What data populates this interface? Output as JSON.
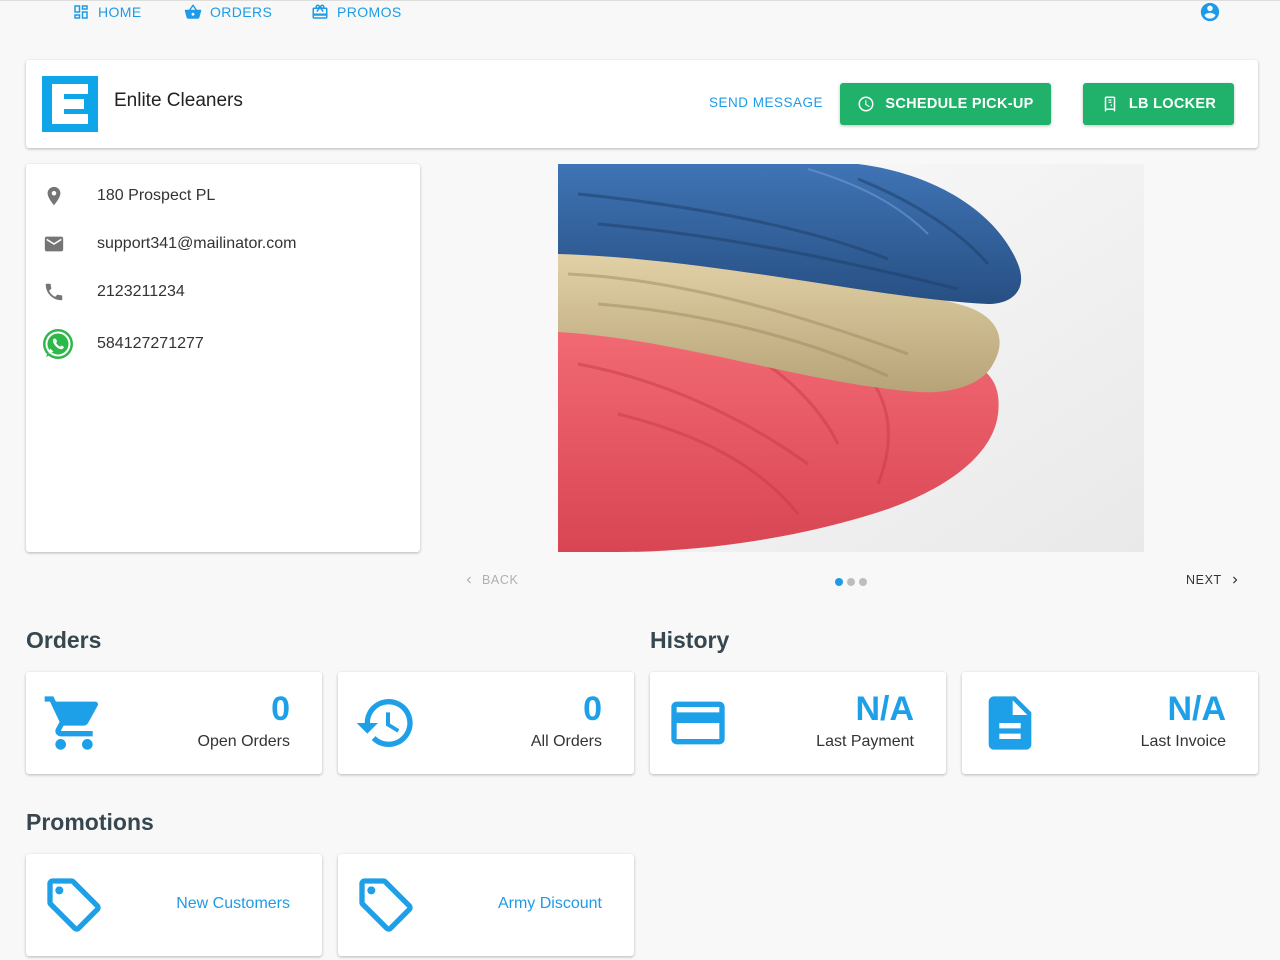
{
  "nav": {
    "items": [
      {
        "label": "HOME",
        "icon": "dashboard-icon"
      },
      {
        "label": "ORDERS",
        "icon": "basket-icon"
      },
      {
        "label": "PROMOS",
        "icon": "redeem-icon"
      }
    ],
    "account_icon": "account-circle-icon"
  },
  "header": {
    "business_name": "Enlite Cleaners",
    "logo_letter": "E",
    "send_message_label": "SEND MESSAGE",
    "schedule_label": "SCHEDULE PICK-UP",
    "locker_label": "LB LOCKER"
  },
  "contact": {
    "address": "180 Prospect PL",
    "email": "support341@mailinator.com",
    "phone": "2123211234",
    "whatsapp": "584127271277"
  },
  "carousel": {
    "back_label": "BACK",
    "next_label": "NEXT",
    "slide_count": 3,
    "active_slide": 0
  },
  "orders": {
    "title": "Orders",
    "cards": [
      {
        "value": "0",
        "label": "Open Orders",
        "icon": "cart-icon"
      },
      {
        "value": "0",
        "label": "All Orders",
        "icon": "history-icon"
      }
    ]
  },
  "history": {
    "title": "History",
    "cards": [
      {
        "value": "N/A",
        "label": "Last Payment",
        "icon": "credit-card-icon"
      },
      {
        "value": "N/A",
        "label": "Last Invoice",
        "icon": "document-icon"
      }
    ]
  },
  "promotions": {
    "title": "Promotions",
    "cards": [
      {
        "label": "New Customers",
        "icon": "tag-icon"
      },
      {
        "label": "Army Discount",
        "icon": "tag-icon"
      }
    ]
  },
  "colors": {
    "accent": "#1e9be6",
    "green": "#20b26b",
    "logo_bg": "#0ea5e9"
  }
}
